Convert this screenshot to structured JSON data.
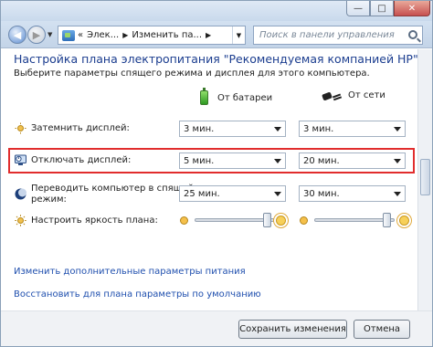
{
  "window": {
    "minimize_symbol": "—",
    "maximize_symbol": "□",
    "close_symbol": "✕"
  },
  "nav": {
    "back_symbol": "◀",
    "forward_symbol": "▶",
    "breadcrumb_prefix": "«",
    "breadcrumb": [
      "Элек...",
      "Изменить па..."
    ],
    "separator": "▶",
    "refresh_symbol": "↻",
    "search_placeholder": "Поиск в панели управления"
  },
  "page": {
    "title": "Настройка плана электропитания \"Рекомендуемая компанией HP\"",
    "subtitle": "Выберите параметры спящего режима и дисплея для этого компьютера."
  },
  "columns": {
    "battery": "От батареи",
    "ac": "От сети"
  },
  "settings": [
    {
      "label": "Затемнить дисплей:",
      "battery": "3 мин.",
      "ac": "3 мин."
    },
    {
      "label": "Отключать дисплей:",
      "battery": "5 мин.",
      "ac": "20 мин."
    },
    {
      "label_line1": "Переводить компьютер в спящий",
      "label_line2": "режим:",
      "battery": "25 мин.",
      "ac": "30 мин."
    }
  ],
  "brightness": {
    "label": "Настроить яркость плана:",
    "battery_level": 0.95,
    "ac_level": 0.95
  },
  "links": {
    "advanced": "Изменить дополнительные параметры питания",
    "restore": "Восстановить для плана параметры по умолчанию"
  },
  "buttons": {
    "save": "Сохранить изменения",
    "cancel": "Отмена"
  },
  "colors": {
    "title_blue": "#1b3d8f",
    "link_blue": "#1f4fae",
    "highlight_red": "#e12d2d"
  }
}
